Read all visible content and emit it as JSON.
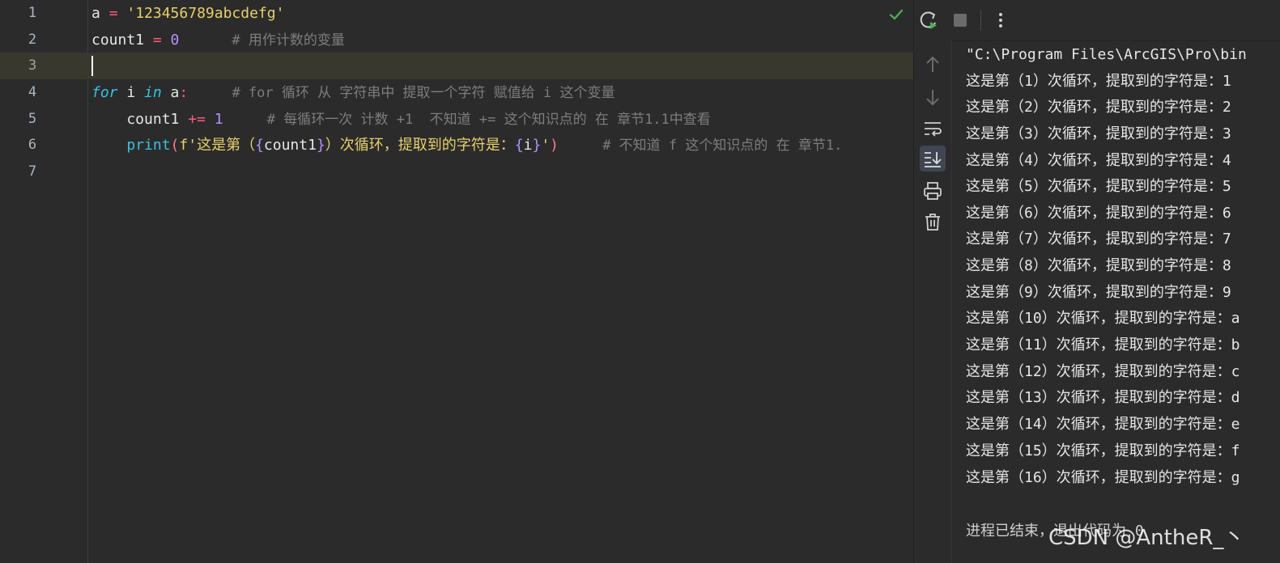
{
  "editor": {
    "line_numbers": [
      "1",
      "2",
      "3",
      "4",
      "5",
      "6",
      "7"
    ],
    "lines": [
      {
        "segments": [
          [
            "plain",
            "a "
          ],
          [
            "op",
            "="
          ],
          [
            "plain",
            " "
          ],
          [
            "str",
            "'123456789abcdefg'"
          ]
        ]
      },
      {
        "segments": [
          [
            "plain",
            "count1 "
          ],
          [
            "op",
            "="
          ],
          [
            "plain",
            " "
          ],
          [
            "num",
            "0"
          ],
          [
            "plain",
            "      "
          ],
          [
            "cmt",
            "# 用作计数的变量"
          ]
        ]
      },
      {
        "segments": []
      },
      {
        "segments": [
          [
            "kw",
            "for"
          ],
          [
            "plain",
            " i "
          ],
          [
            "kw",
            "in"
          ],
          [
            "plain",
            " a"
          ],
          [
            "op",
            ":"
          ],
          [
            "plain",
            "     "
          ],
          [
            "cmt",
            "# for 循环 从 字符串中 提取一个字符 赋值给 i 这个变量"
          ]
        ]
      },
      {
        "segments": [
          [
            "plain",
            "    count1 "
          ],
          [
            "op",
            "+="
          ],
          [
            "plain",
            " "
          ],
          [
            "num",
            "1"
          ],
          [
            "plain",
            "     "
          ],
          [
            "cmt",
            "# 每循环一次 计数 +1  不知道 += 这个知识点的 在 章节1.1中查看"
          ]
        ]
      },
      {
        "segments": [
          [
            "plain",
            "    "
          ],
          [
            "fn",
            "print"
          ],
          [
            "par",
            "("
          ],
          [
            "str",
            "f'这是第（"
          ],
          [
            "brace",
            "{"
          ],
          [
            "plain",
            "count1"
          ],
          [
            "brace",
            "}"
          ],
          [
            "str",
            "）次循环，提取到的字符是："
          ],
          [
            "brace",
            "{"
          ],
          [
            "plain",
            "i"
          ],
          [
            "brace",
            "}"
          ],
          [
            "str",
            "'"
          ],
          [
            "par",
            ")"
          ],
          [
            "plain",
            "     "
          ],
          [
            "cmt",
            "# 不知道 f 这个知识点的 在 章节1."
          ]
        ]
      },
      {
        "segments": []
      }
    ],
    "status_icon": "check-icon",
    "status_color": "#4caf50"
  },
  "run_panel": {
    "toolbar": {
      "rerun_icon": "rerun-icon",
      "stop_icon": "stop-icon",
      "more_icon": "more-vertical-icon"
    },
    "side_tools": [
      "arrow-up-icon",
      "arrow-down-icon",
      "soft-wrap-icon",
      "scroll-to-end-icon",
      "print-icon",
      "trash-icon"
    ],
    "output": [
      "\"C:\\Program Files\\ArcGIS\\Pro\\bin",
      "这是第（1）次循环，提取到的字符是：1",
      "这是第（2）次循环，提取到的字符是：2",
      "这是第（3）次循环，提取到的字符是：3",
      "这是第（4）次循环，提取到的字符是：4",
      "这是第（5）次循环，提取到的字符是：5",
      "这是第（6）次循环，提取到的字符是：6",
      "这是第（7）次循环，提取到的字符是：7",
      "这是第（8）次循环，提取到的字符是：8",
      "这是第（9）次循环，提取到的字符是：9",
      "这是第（10）次循环，提取到的字符是：a",
      "这是第（11）次循环，提取到的字符是：b",
      "这是第（12）次循环，提取到的字符是：c",
      "这是第（13）次循环，提取到的字符是：d",
      "这是第（14）次循环，提取到的字符是：e",
      "这是第（15）次循环，提取到的字符是：f",
      "这是第（16）次循环，提取到的字符是：g",
      "",
      "进程已结束，退出代码为 0"
    ]
  },
  "watermark": "CSDN @AntheR_丶"
}
